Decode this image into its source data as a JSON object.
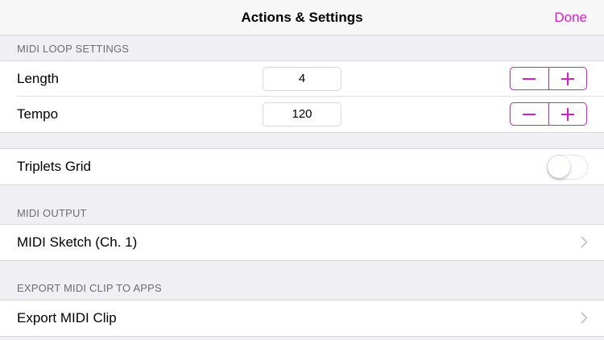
{
  "nav": {
    "title": "Actions & Settings",
    "done_label": "Done"
  },
  "midi_loop": {
    "header": "MIDI LOOP SETTINGS",
    "length": {
      "label": "Length",
      "value": "4"
    },
    "tempo": {
      "label": "Tempo",
      "value": "120"
    }
  },
  "triplets": {
    "label": "Triplets Grid",
    "enabled": false
  },
  "midi_output": {
    "header": "MIDI OUTPUT",
    "item_label": "MIDI Sketch (Ch. 1)"
  },
  "export": {
    "header": "EXPORT MIDI CLIP TO APPS",
    "item_label": "Export MIDI Clip"
  },
  "colors": {
    "accent": "#d21fcb",
    "background": "#efeff4",
    "section_header": "#6d6d72"
  },
  "icons": {
    "minus": "minus-icon",
    "plus": "plus-icon",
    "chevron": "chevron-right-icon"
  }
}
